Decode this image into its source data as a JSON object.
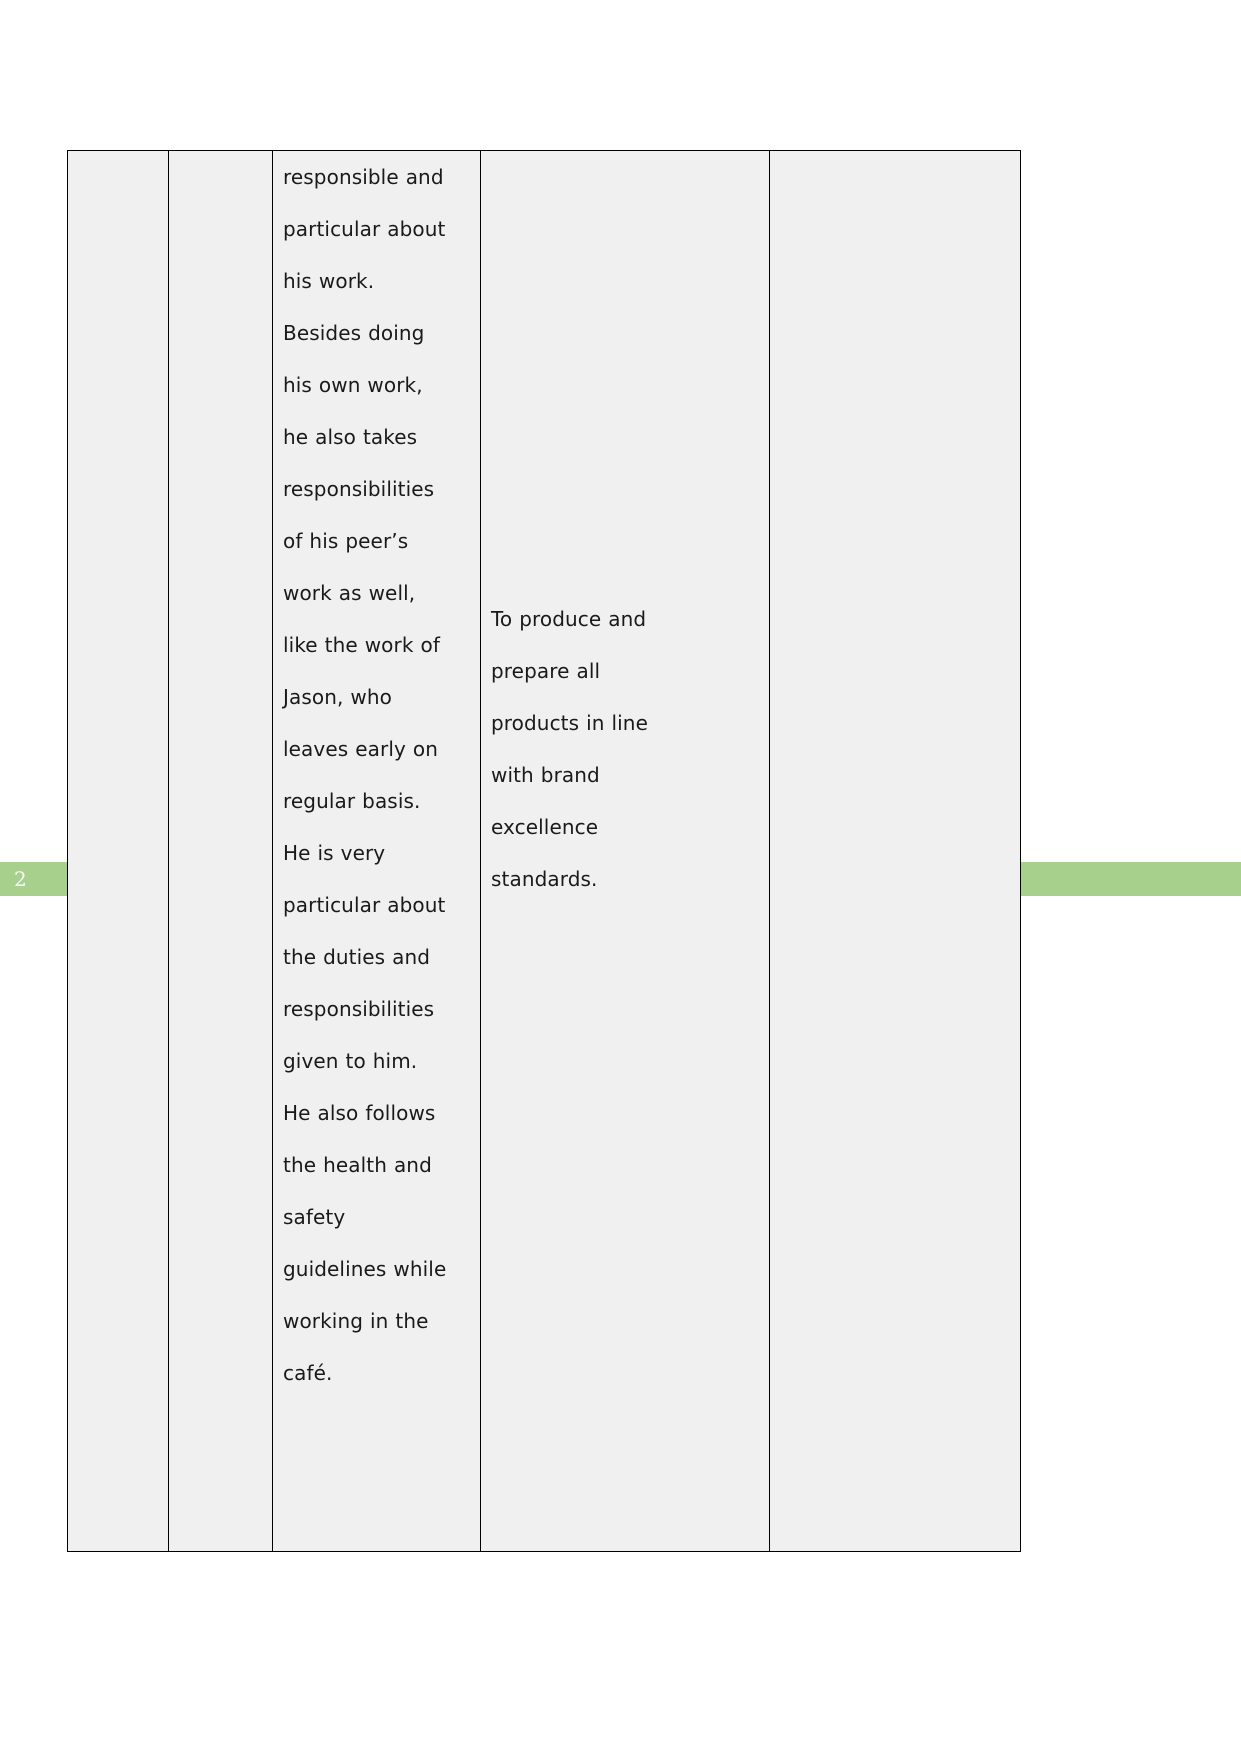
{
  "page": {
    "number_marker": "2",
    "band_color": "#a8d08d",
    "background": "#ffffff",
    "cell_background": "#f0f0f0",
    "border_color": "#000000"
  },
  "table": {
    "columns": [
      {
        "name": "column-1",
        "lines": []
      },
      {
        "name": "column-2",
        "lines": []
      },
      {
        "name": "column-3",
        "lines": [
          "responsible and",
          "particular about",
          "his work.",
          "Besides doing",
          "his own work,",
          "he also takes",
          "responsibilities",
          "of his peer’s",
          "work as well,",
          "like the work of",
          "Jason, who",
          "leaves early on",
          "regular basis.",
          "He is very",
          "particular about",
          "the duties and",
          "responsibilities",
          "given to him.",
          "He also follows",
          "the health and",
          "safety",
          "guidelines while",
          "working in the",
          "café."
        ]
      },
      {
        "name": "column-4",
        "lines": [
          "To produce and",
          "prepare all",
          "products in line",
          "with brand",
          "excellence",
          "standards."
        ]
      },
      {
        "name": "column-5",
        "lines": []
      }
    ]
  }
}
